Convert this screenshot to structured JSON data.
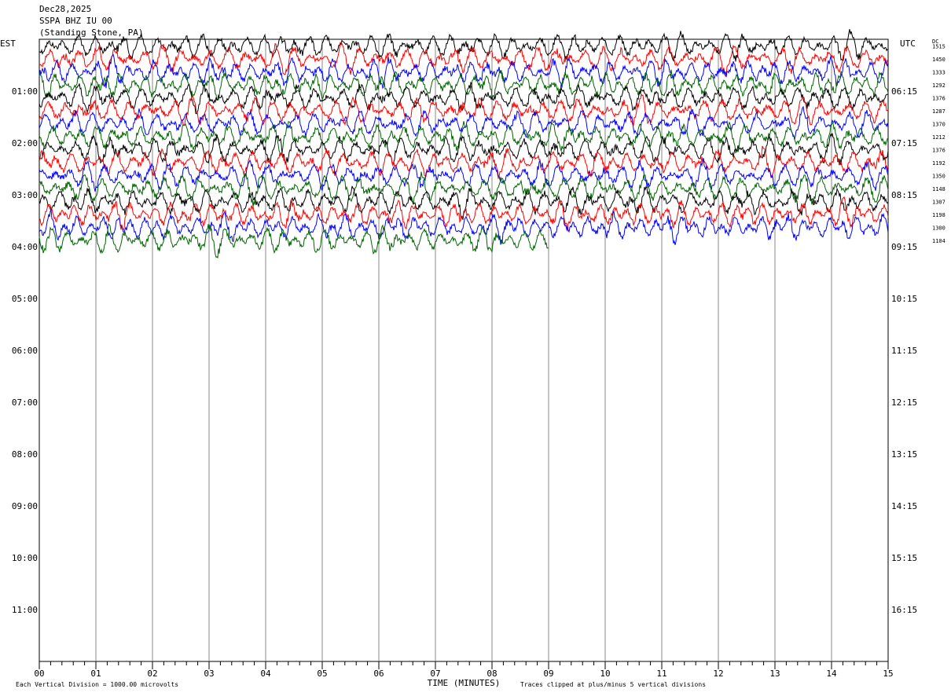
{
  "header": {
    "date": "Dec28,2025",
    "station": "SSPA BHZ IU 00",
    "location": "(Standing Stone, PA)"
  },
  "left_axis_label": "EST",
  "right_axis_label": "UTC",
  "dc_label": "DC",
  "footer": {
    "scale_note": "Each Vertical Division = 1000.00 microvolts",
    "clip_note": "Traces clipped at plus/minus 5 vertical divisions"
  },
  "chart_data": {
    "type": "line",
    "title": "",
    "xlabel": "TIME (MINUTES)",
    "xlim": [
      0,
      15
    ],
    "x_ticks": [
      "00",
      "01",
      "02",
      "03",
      "04",
      "05",
      "06",
      "07",
      "08",
      "09",
      "10",
      "11",
      "12",
      "13",
      "14",
      "15"
    ],
    "minor_ticks_per_minute": 5,
    "grid_vertical": true,
    "left_hour_labels": [
      "01:00",
      "02:00",
      "03:00",
      "04:00",
      "05:00",
      "06:00",
      "07:00",
      "08:00",
      "09:00",
      "10:00",
      "11:00"
    ],
    "right_hour_labels": [
      "06:15",
      "07:15",
      "08:15",
      "09:15",
      "10:15",
      "11:15",
      "12:15",
      "13:15",
      "14:15",
      "15:15",
      "16:15"
    ],
    "trace_colors": [
      "#000000",
      "#ff0000",
      "#0000ff",
      "#006400"
    ],
    "total_rows": 48,
    "rows_per_hour": 4,
    "minutes_per_row": 15,
    "traces_plotted": 16,
    "last_trace_end_minute": 9.0,
    "dc_offsets": [
      "1515",
      "1450",
      "1333",
      "1292",
      "1376",
      "1287",
      "1370",
      "1212",
      "1376",
      "1192",
      "1350",
      "1148",
      "1307",
      "1198",
      "1300",
      "1104"
    ]
  }
}
